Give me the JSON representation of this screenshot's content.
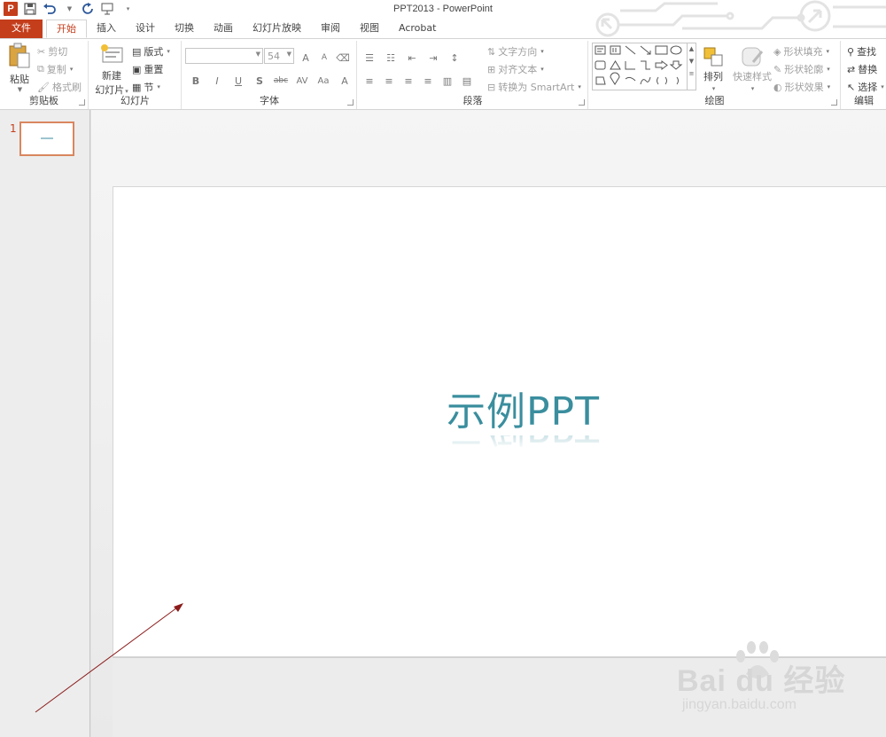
{
  "window": {
    "title": "PPT2013 - PowerPoint"
  },
  "qat": {
    "app_icon_label": "P"
  },
  "tabs": [
    {
      "label": "文件"
    },
    {
      "label": "开始"
    },
    {
      "label": "插入"
    },
    {
      "label": "设计"
    },
    {
      "label": "切换"
    },
    {
      "label": "动画"
    },
    {
      "label": "幻灯片放映"
    },
    {
      "label": "审阅"
    },
    {
      "label": "视图"
    },
    {
      "label": "Acrobat"
    }
  ],
  "ribbon": {
    "clipboard": {
      "label": "剪贴板",
      "paste": "粘贴",
      "cut": "剪切",
      "copy": "复制",
      "format_painter": "格式刷"
    },
    "slides": {
      "label": "幻灯片",
      "new_slide_1": "新建",
      "new_slide_2": "幻灯片",
      "layout": "版式",
      "reset": "重置",
      "section": "节"
    },
    "font": {
      "label": "字体",
      "font_name": "",
      "font_size": "54",
      "bold": "B",
      "italic": "I",
      "underline": "U",
      "shadow": "S",
      "strike": "abc",
      "spacing": "AV",
      "case": "Aa",
      "color": "A",
      "grow": "A",
      "shrink": "A"
    },
    "paragraph": {
      "label": "段落",
      "text_direction": "文字方向",
      "align_text": "对齐文本",
      "smartart": "转换为 SmartArt"
    },
    "drawing": {
      "label": "绘图",
      "arrange": "排列",
      "quick_styles": "快速样式",
      "shape_fill": "形状填充",
      "shape_outline": "形状轮廓",
      "shape_effects": "形状效果"
    },
    "editing": {
      "label": "编辑",
      "find": "查找",
      "replace": "替换",
      "select": "选择"
    }
  },
  "thumbnails": [
    {
      "number": "1"
    }
  ],
  "slide": {
    "title": "示例PPT"
  },
  "watermark": {
    "brand": "Bai du 经验",
    "url": "jingyan.baidu.com"
  },
  "colors": {
    "accent": "#c43e1c",
    "title_text": "#3a8e9e",
    "annotation_arrow": "#8b1a1a"
  }
}
